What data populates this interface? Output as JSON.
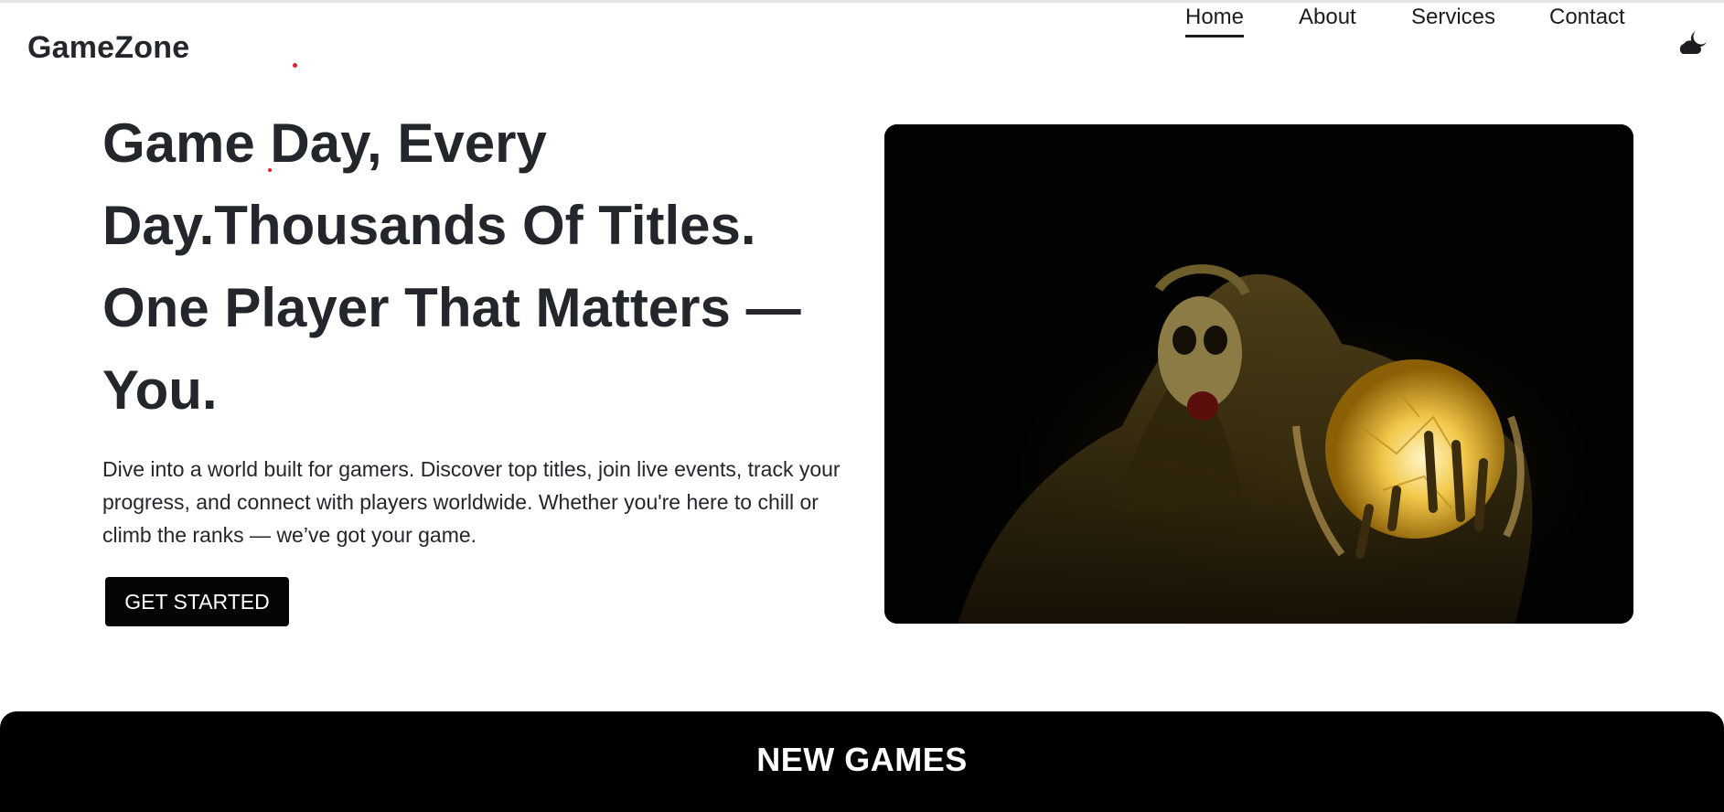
{
  "brand": {
    "name": "GameZone"
  },
  "nav": {
    "items": [
      {
        "label": "Home",
        "active": true
      },
      {
        "label": "About",
        "active": false
      },
      {
        "label": "Services",
        "active": false
      },
      {
        "label": "Contact",
        "active": false
      }
    ],
    "theme_toggle_icon": "moon-cloud-icon"
  },
  "hero": {
    "title": "Game Day, Every Day.Thousands Of Titles. One Player That Matters — You.",
    "description": "Dive into a world built for gamers. Discover top titles, join live events, track your progress, and connect with players worldwide. Whether you're here to chill or climb the ranks — we’ve got your game.",
    "cta_label": "GET STARTED",
    "image_icon": "skeleton-crystal-ball-image"
  },
  "section": {
    "new_games_title": "NEW GAMES"
  },
  "colors": {
    "text": "#23262b",
    "background": "#ffffff",
    "button": "#050505",
    "accent_dot": "#e0202a",
    "image_glow": "#f2c84a"
  }
}
